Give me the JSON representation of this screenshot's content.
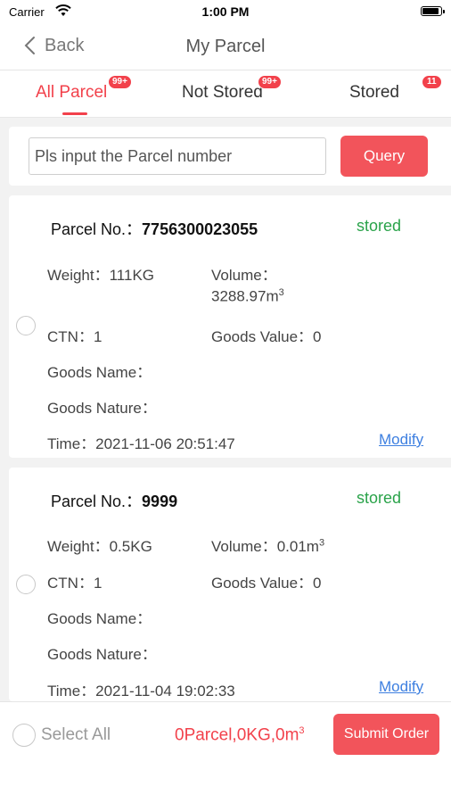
{
  "status_bar": {
    "carrier": "Carrier",
    "time": "1:00 PM"
  },
  "nav": {
    "back_label": "Back",
    "title": "My Parcel"
  },
  "tabs": [
    {
      "label": "All Parcel",
      "badge": "99+",
      "active": true
    },
    {
      "label": "Not Stored",
      "badge": "99+",
      "active": false
    },
    {
      "label": "Stored",
      "badge": "11",
      "active": false
    }
  ],
  "search": {
    "placeholder": "Pls input the Parcel number",
    "value": "",
    "button_label": "Query"
  },
  "parcels": [
    {
      "no_label": "Parcel No.：",
      "no": "7756300023055",
      "status": "stored",
      "weight": "Weight：111KG",
      "volume_label": "Volume：",
      "volume_value": "3288.97m",
      "volume_unit_sup": "3",
      "ctn": "CTN：1",
      "goods_value": "Goods Value：0",
      "goods_name": "Goods Name：",
      "goods_nature": "Goods Nature：",
      "time": "Time：2021-11-06 20:51:47",
      "modify_label": "Modify"
    },
    {
      "no_label": "Parcel No.：",
      "no": "9999",
      "status": "stored",
      "weight": "Weight：0.5KG",
      "volume_label": "Volume：",
      "volume_value": "0.01m",
      "volume_unit_sup": "3",
      "ctn": "CTN：1",
      "goods_value": "Goods Value：0",
      "goods_name": "Goods Name：",
      "goods_nature": "Goods Nature：",
      "time": "Time：2021-11-04 19:02:33",
      "modify_label": "Modify"
    }
  ],
  "footer": {
    "select_all_label": "Select All",
    "summary_text": "0Parcel,0KG,0m",
    "summary_sup": "3",
    "submit_label": "Submit Order"
  },
  "colors": {
    "accent": "#f2414b",
    "button": "#f2545b",
    "status_green": "#2aa34a",
    "link": "#3d7fe0"
  },
  "icons": [
    "wifi-icon",
    "battery-icon",
    "back-chevron-icon"
  ]
}
